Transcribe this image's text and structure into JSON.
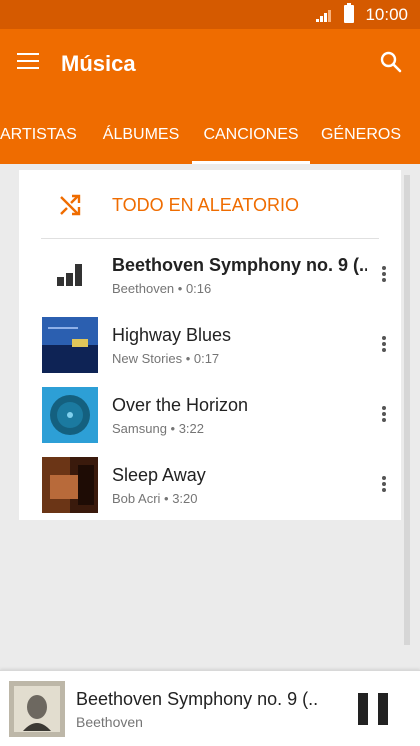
{
  "status_bar": {
    "time": "10:00"
  },
  "app_bar": {
    "title": "Música"
  },
  "tabs": [
    {
      "label": "ARTISTAS"
    },
    {
      "label": "ÁLBUMES"
    },
    {
      "label": "CANCIONES",
      "active": true
    },
    {
      "label": "GÉNEROS"
    }
  ],
  "shuffle": {
    "label": "TODO EN ALEATORIO"
  },
  "songs": [
    {
      "title": "Beethoven Symphony no. 9 (..",
      "subtitle": "Beethoven • 0:16",
      "playing": true
    },
    {
      "title": "Highway Blues",
      "subtitle": "New Stories • 0:17"
    },
    {
      "title": "Over the Horizon",
      "subtitle": "Samsung • 3:22"
    },
    {
      "title": "Sleep Away",
      "subtitle": "Bob Acri • 3:20"
    }
  ],
  "now_playing": {
    "title": "Beethoven Symphony no. 9 (..",
    "artist": "Beethoven"
  },
  "colors": {
    "accent": "#ef6c00",
    "status_bar": "#d55a00"
  }
}
